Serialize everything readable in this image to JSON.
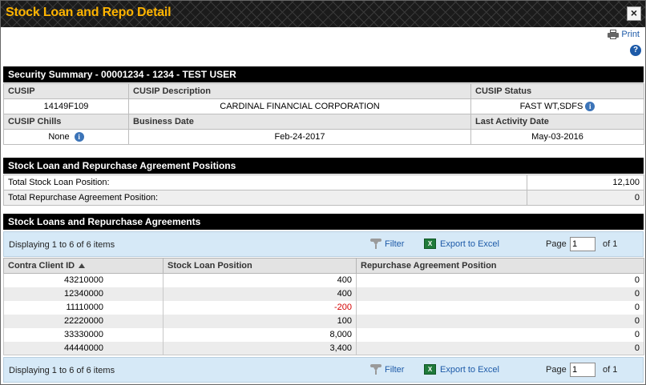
{
  "window": {
    "title": "Stock Loan and Repo Detail",
    "close_glyph": "×"
  },
  "toolbar": {
    "print_label": "Print",
    "help_glyph": "?"
  },
  "security_summary": {
    "header": "Security Summary - 00001234 - 1234 - TEST USER",
    "labels": {
      "cusip": "CUSIP",
      "cusip_description": "CUSIP Description",
      "cusip_status": "CUSIP Status",
      "cusip_chills": "CUSIP Chills",
      "business_date": "Business Date",
      "last_activity_date": "Last Activity Date"
    },
    "values": {
      "cusip": "14149F109",
      "cusip_description": "CARDINAL FINANCIAL CORPORATION",
      "cusip_status": "FAST WT,SDFS",
      "cusip_chills": "None",
      "business_date": "Feb-24-2017",
      "last_activity_date": "May-03-2016"
    }
  },
  "positions": {
    "header": "Stock Loan and Repurchase Agreement Positions",
    "rows": [
      {
        "label": "Total Stock Loan Position:",
        "value": "12,100"
      },
      {
        "label": "Total Repurchase Agreement Position:",
        "value": "0"
      }
    ]
  },
  "loans": {
    "header": "Stock Loans and Repurchase Agreements",
    "pager": {
      "display_text": "Displaying 1 to 6 of 6 items",
      "filter_label": "Filter",
      "export_label": "Export to Excel",
      "page_label": "Page",
      "page_value": "1",
      "of_label": "of 1"
    },
    "columns": [
      "Contra Client ID",
      "Stock Loan Position",
      "Repurchase Agreement Position"
    ],
    "rows": [
      {
        "client_id": "43210000",
        "stock_loan": "400",
        "repo": "0"
      },
      {
        "client_id": "12340000",
        "stock_loan": "400",
        "repo": "0"
      },
      {
        "client_id": "11110000",
        "stock_loan": "-200",
        "repo": "0"
      },
      {
        "client_id": "22220000",
        "stock_loan": "100",
        "repo": "0"
      },
      {
        "client_id": "33330000",
        "stock_loan": "8,000",
        "repo": "0"
      },
      {
        "client_id": "44440000",
        "stock_loan": "3,400",
        "repo": "0"
      }
    ]
  },
  "colors": {
    "title_text": "#ffb400",
    "link": "#1d5aa8",
    "negative": "#d40000",
    "pager_bg": "#d6e9f7"
  }
}
